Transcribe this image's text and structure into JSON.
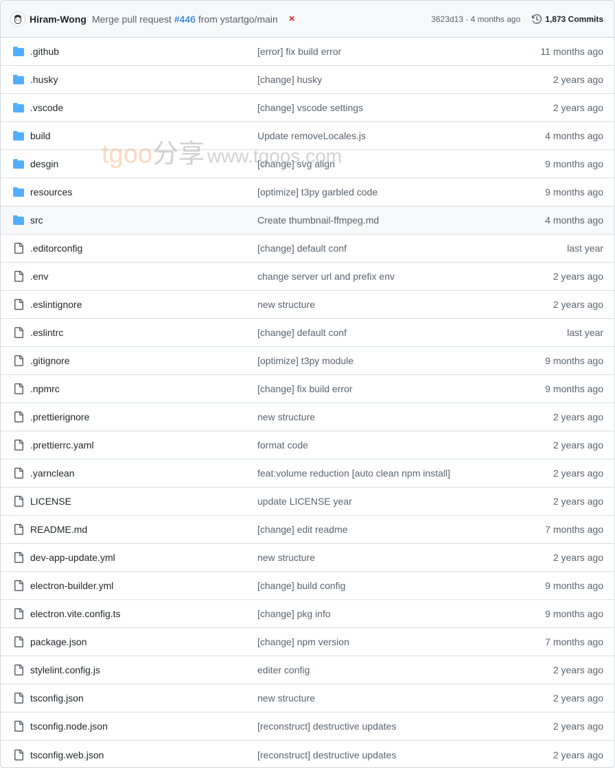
{
  "commit": {
    "author": "Hiram-Wong",
    "message_prefix": "Merge pull request ",
    "pr_link": "#446",
    "message_suffix": " from ystartgo/main",
    "status": "×",
    "sha_age": "3623d13 · 4 months ago",
    "commits_label": "1,873 Commits"
  },
  "watermark": {
    "brand": "tgoo",
    "cn": "分享",
    "url": "www.tgoos.com"
  },
  "colors": {
    "folder": "#54aeff",
    "link": "#0969da",
    "fail": "#d1242f"
  },
  "files": [
    {
      "name": ".github",
      "type": "folder",
      "message": "[error] fix build error",
      "age": "11 months ago"
    },
    {
      "name": ".husky",
      "type": "folder",
      "message": "[change] husky",
      "age": "2 years ago"
    },
    {
      "name": ".vscode",
      "type": "folder",
      "message": "[change] vscode settings",
      "age": "2 years ago"
    },
    {
      "name": "build",
      "type": "folder",
      "message": "Update removeLocales.js",
      "age": "4 months ago"
    },
    {
      "name": "desgin",
      "type": "folder",
      "message": "[change] svg align",
      "age": "9 months ago"
    },
    {
      "name": "resources",
      "type": "folder",
      "message": "[optimize] t3py garbled code",
      "age": "9 months ago"
    },
    {
      "name": "src",
      "type": "folder",
      "message": "Create thumbnail-ffmpeg.md",
      "age": "4 months ago"
    },
    {
      "name": ".editorconfig",
      "type": "file",
      "message": "[change] default conf",
      "age": "last year"
    },
    {
      "name": ".env",
      "type": "file",
      "message": "change server url and prefix env",
      "age": "2 years ago"
    },
    {
      "name": ".eslintignore",
      "type": "file",
      "message": "new structure",
      "age": "2 years ago"
    },
    {
      "name": ".eslintrc",
      "type": "file",
      "message": "[change] default conf",
      "age": "last year"
    },
    {
      "name": ".gitignore",
      "type": "file",
      "message": "[optimize] t3py module",
      "age": "9 months ago"
    },
    {
      "name": ".npmrc",
      "type": "file",
      "message": "[change] fix build error",
      "age": "9 months ago"
    },
    {
      "name": ".prettierignore",
      "type": "file",
      "message": "new structure",
      "age": "2 years ago"
    },
    {
      "name": ".prettierrc.yaml",
      "type": "file",
      "message": "format code",
      "age": "2 years ago"
    },
    {
      "name": ".yarnclean",
      "type": "file",
      "message": "feat:volume reduction [auto clean npm install]",
      "age": "2 years ago"
    },
    {
      "name": "LICENSE",
      "type": "file",
      "message": "update LICENSE year",
      "age": "2 years ago"
    },
    {
      "name": "README.md",
      "type": "file",
      "message": "[change] edit readme",
      "age": "7 months ago"
    },
    {
      "name": "dev-app-update.yml",
      "type": "file",
      "message": "new structure",
      "age": "2 years ago"
    },
    {
      "name": "electron-builder.yml",
      "type": "file",
      "message": "[change] build config",
      "age": "9 months ago"
    },
    {
      "name": "electron.vite.config.ts",
      "type": "file",
      "message": "[change] pkg info",
      "age": "9 months ago"
    },
    {
      "name": "package.json",
      "type": "file",
      "message": "[change] npm version",
      "age": "7 months ago"
    },
    {
      "name": "stylelint.config.js",
      "type": "file",
      "message": "editer config",
      "age": "2 years ago"
    },
    {
      "name": "tsconfig.json",
      "type": "file",
      "message": "new structure",
      "age": "2 years ago"
    },
    {
      "name": "tsconfig.node.json",
      "type": "file",
      "message": "[reconstruct] destructive updates",
      "age": "2 years ago"
    },
    {
      "name": "tsconfig.web.json",
      "type": "file",
      "message": "[reconstruct] destructive updates",
      "age": "2 years ago"
    }
  ]
}
